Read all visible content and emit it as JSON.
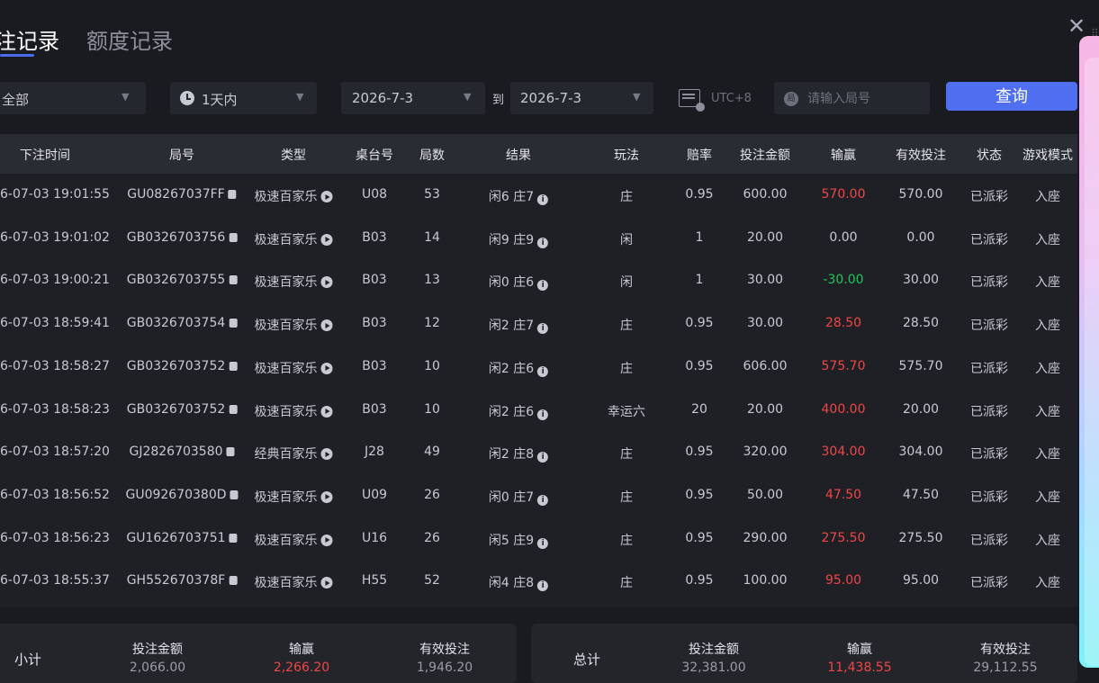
{
  "tabs": [
    {
      "label": "注记录",
      "active": true
    },
    {
      "label": "额度记录",
      "active": false
    }
  ],
  "filters": {
    "category": "全部",
    "time_range": "1天内",
    "date_from": "2026-7-3",
    "to_label": "到",
    "date_to": "2026-7-3",
    "timezone": "UTC+8",
    "search_placeholder": "请输入局号",
    "query_label": "查询"
  },
  "table": {
    "columns": [
      "下注时间",
      "局号",
      "类型",
      "桌台号",
      "局数",
      "结果",
      "玩法",
      "赔率",
      "投注金额",
      "输赢",
      "有效投注",
      "状态",
      "游戏模式"
    ],
    "rows": [
      {
        "time": "6-07-03 19:01:55",
        "round_id": "GU08267037FF",
        "type": "极速百家乐",
        "table": "U08",
        "round_no": "53",
        "result": "闲6 庄7",
        "bet": "庄",
        "odds": "0.95",
        "amount": "600.00",
        "winloss": "570.00",
        "outcome": "win",
        "valid": "570.00",
        "status": "已派彩",
        "mode": "入座"
      },
      {
        "time": "6-07-03 19:01:02",
        "round_id": "GB0326703756",
        "type": "极速百家乐",
        "table": "B03",
        "round_no": "14",
        "result": "闲9 庄9",
        "bet": "闲",
        "odds": "1",
        "amount": "20.00",
        "winloss": "0.00",
        "outcome": "push",
        "valid": "0.00",
        "status": "已派彩",
        "mode": "入座"
      },
      {
        "time": "6-07-03 19:00:21",
        "round_id": "GB0326703755",
        "type": "极速百家乐",
        "table": "B03",
        "round_no": "13",
        "result": "闲0 庄6",
        "bet": "闲",
        "odds": "1",
        "amount": "30.00",
        "winloss": "-30.00",
        "outcome": "lose",
        "valid": "30.00",
        "status": "已派彩",
        "mode": "入座"
      },
      {
        "time": "6-07-03 18:59:41",
        "round_id": "GB0326703754",
        "type": "极速百家乐",
        "table": "B03",
        "round_no": "12",
        "result": "闲2 庄7",
        "bet": "庄",
        "odds": "0.95",
        "amount": "30.00",
        "winloss": "28.50",
        "outcome": "win",
        "valid": "28.50",
        "status": "已派彩",
        "mode": "入座"
      },
      {
        "time": "6-07-03 18:58:27",
        "round_id": "GB0326703752",
        "type": "极速百家乐",
        "table": "B03",
        "round_no": "10",
        "result": "闲2 庄6",
        "bet": "庄",
        "odds": "0.95",
        "amount": "606.00",
        "winloss": "575.70",
        "outcome": "win",
        "valid": "575.70",
        "status": "已派彩",
        "mode": "入座"
      },
      {
        "time": "6-07-03 18:58:23",
        "round_id": "GB0326703752",
        "type": "极速百家乐",
        "table": "B03",
        "round_no": "10",
        "result": "闲2 庄6",
        "bet": "幸运六",
        "odds": "20",
        "amount": "20.00",
        "winloss": "400.00",
        "outcome": "win",
        "valid": "20.00",
        "status": "已派彩",
        "mode": "入座"
      },
      {
        "time": "6-07-03 18:57:20",
        "round_id": "GJ2826703580",
        "type": "经典百家乐",
        "table": "J28",
        "round_no": "49",
        "result": "闲2 庄8",
        "bet": "庄",
        "odds": "0.95",
        "amount": "320.00",
        "winloss": "304.00",
        "outcome": "win",
        "valid": "304.00",
        "status": "已派彩",
        "mode": "入座"
      },
      {
        "time": "6-07-03 18:56:52",
        "round_id": "GU092670380D",
        "type": "极速百家乐",
        "table": "U09",
        "round_no": "26",
        "result": "闲0 庄7",
        "bet": "庄",
        "odds": "0.95",
        "amount": "50.00",
        "winloss": "47.50",
        "outcome": "win",
        "valid": "47.50",
        "status": "已派彩",
        "mode": "入座"
      },
      {
        "time": "6-07-03 18:56:23",
        "round_id": "GU1626703751",
        "type": "极速百家乐",
        "table": "U16",
        "round_no": "26",
        "result": "闲5 庄9",
        "bet": "庄",
        "odds": "0.95",
        "amount": "290.00",
        "winloss": "275.50",
        "outcome": "win",
        "valid": "275.50",
        "status": "已派彩",
        "mode": "入座"
      },
      {
        "time": "6-07-03 18:55:37",
        "round_id": "GH552670378F",
        "type": "极速百家乐",
        "table": "H55",
        "round_no": "52",
        "result": "闲4 庄8",
        "bet": "庄",
        "odds": "0.95",
        "amount": "100.00",
        "winloss": "95.00",
        "outcome": "win",
        "valid": "95.00",
        "status": "已派彩",
        "mode": "入座"
      }
    ]
  },
  "subtotal": {
    "title": "小计",
    "items": [
      {
        "label": "投注金额",
        "value": "2,066.00"
      },
      {
        "label": "输赢",
        "value": "2,266.20"
      },
      {
        "label": "有效投注",
        "value": "1,946.20"
      }
    ]
  },
  "total": {
    "title": "总计",
    "items": [
      {
        "label": "投注金额",
        "value": "32,381.00"
      },
      {
        "label": "输赢",
        "value": "11,438.55"
      },
      {
        "label": "有效投注",
        "value": "29,112.55"
      }
    ]
  },
  "colors": {
    "accent": "#4f6ff0",
    "win": "#f04646",
    "lose": "#1ec85a"
  }
}
